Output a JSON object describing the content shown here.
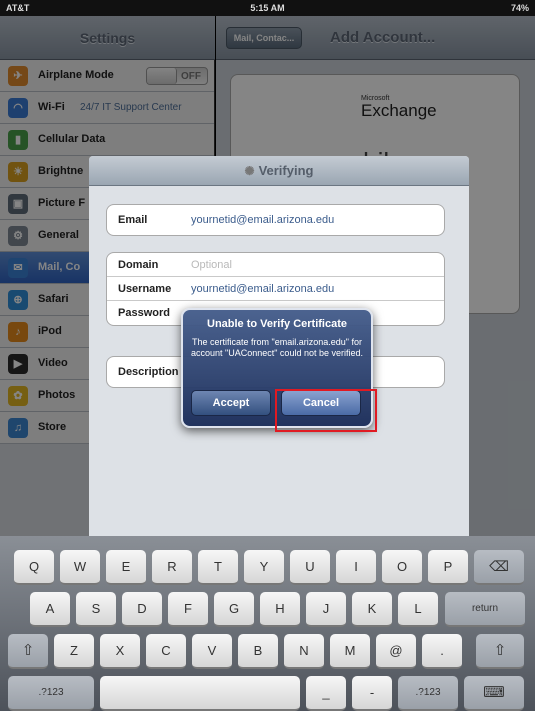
{
  "status_bar": {
    "carrier": "AT&T",
    "time": "5:15 AM",
    "battery": "74%"
  },
  "settings": {
    "title": "Settings",
    "items": [
      {
        "label": "Airplane Mode",
        "value": "",
        "toggle": "OFF",
        "icon": "airplane-icon",
        "color": "#e08a2c"
      },
      {
        "label": "Wi-Fi",
        "value": "24/7 IT Support Center",
        "toggle": "",
        "icon": "wifi-icon",
        "color": "#3a7bd5"
      },
      {
        "label": "Cellular Data",
        "value": "",
        "toggle": "",
        "icon": "cellular-icon",
        "color": "#4aa04a"
      },
      {
        "label": "Brightne",
        "value": "",
        "toggle": "",
        "icon": "brightness-icon",
        "color": "#d9a020"
      },
      {
        "label": "Picture F",
        "value": "",
        "toggle": "",
        "icon": "picture-frame-icon",
        "color": "#5e6b7a"
      },
      {
        "label": "General",
        "value": "",
        "toggle": "",
        "icon": "gear-icon",
        "color": "#7f8894"
      },
      {
        "label": "Mail, Co",
        "value": "",
        "toggle": "",
        "icon": "mail-icon",
        "color": "#3b82d6",
        "selected": true
      },
      {
        "label": "Safari",
        "value": "",
        "toggle": "",
        "icon": "compass-icon",
        "color": "#2f8ed8"
      },
      {
        "label": "iPod",
        "value": "",
        "toggle": "",
        "icon": "ipod-icon",
        "color": "#e78b1c"
      },
      {
        "label": "Video",
        "value": "",
        "toggle": "",
        "icon": "video-icon",
        "color": "#2b2b2b"
      },
      {
        "label": "Photos",
        "value": "",
        "toggle": "",
        "icon": "sunflower-icon",
        "color": "#e3b623"
      },
      {
        "label": "Store",
        "value": "",
        "toggle": "",
        "icon": "store-icon",
        "color": "#3d86d1"
      }
    ]
  },
  "detail": {
    "back_label": "Mail, Contac...",
    "title": "Add Account...",
    "exchange_small": "Microsoft",
    "exchange": "Exchange",
    "mobile": "mobile",
    "me": "me"
  },
  "sheet": {
    "title": "Verifying",
    "email_label": "Email",
    "email_value": "yournetid@email.arizona.edu",
    "domain_label": "Domain",
    "domain_placeholder": "Optional",
    "username_label": "Username",
    "username_value": "yournetid@email.arizona.edu",
    "password_label": "Password",
    "description_label": "Description"
  },
  "alert": {
    "title": "Unable to Verify Certificate",
    "message": "The certificate from \"email.arizona.edu\" for account \"UAConnect\" could not be verified.",
    "accept": "Accept",
    "cancel": "Cancel"
  },
  "keyboard": {
    "row1": [
      "Q",
      "W",
      "E",
      "R",
      "T",
      "Y",
      "U",
      "I",
      "O",
      "P"
    ],
    "row2": [
      "A",
      "S",
      "D",
      "F",
      "G",
      "H",
      "J",
      "K",
      "L"
    ],
    "row3": [
      "Z",
      "X",
      "C",
      "V",
      "B",
      "N",
      "M",
      "@",
      "."
    ],
    "return": "return",
    "numbers_left": ".?123",
    "numbers_right": ".?123",
    "underscore": "_",
    "dash": "-",
    "backspace_icon": "backspace-icon",
    "shift_icon": "shift-icon",
    "hide_keyboard_icon": "keyboard-hide-icon"
  }
}
